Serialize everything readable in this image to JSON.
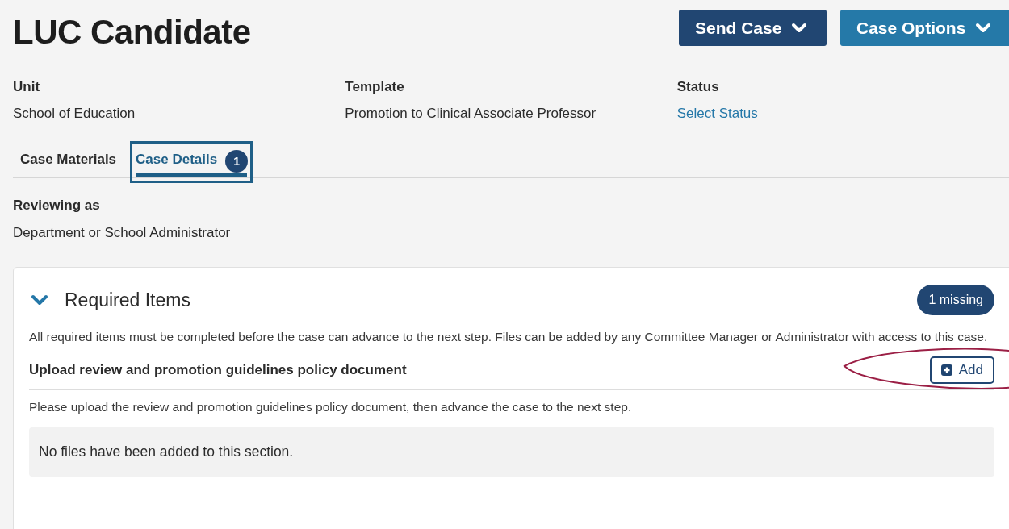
{
  "header": {
    "title": "LUC Candidate",
    "buttons": [
      {
        "label": "Send Case",
        "kind": "dark"
      },
      {
        "label": "Case Options",
        "kind": "light"
      }
    ]
  },
  "meta": [
    {
      "label": "Unit",
      "value": "School of Education",
      "kind": "text"
    },
    {
      "label": "Template",
      "value": "Promotion to Clinical Associate Professor",
      "kind": "text"
    },
    {
      "label": "Status",
      "value": "Select Status",
      "kind": "link"
    }
  ],
  "tabs": [
    {
      "label": "Case Materials",
      "selected": false,
      "focused": false
    },
    {
      "label": "Case Details",
      "selected": true,
      "focused": true,
      "count": "1"
    }
  ],
  "reviewing": {
    "label": "Reviewing as",
    "value": "Department or School Administrator"
  },
  "section": {
    "title": "Required Items",
    "expanded": true,
    "badge": "1 missing",
    "description": "All required items must be completed before the case can advance to the next step. Files can be added by any Committee Manager or Administrator with access to this case.",
    "items": [
      {
        "title": "Upload review and promotion guidelines policy document",
        "button": "Add",
        "highlighted": true,
        "help": "Please upload the review and promotion guidelines policy document, then advance the case to the next step.",
        "empty_message": "No files have been added to this section."
      }
    ]
  }
}
